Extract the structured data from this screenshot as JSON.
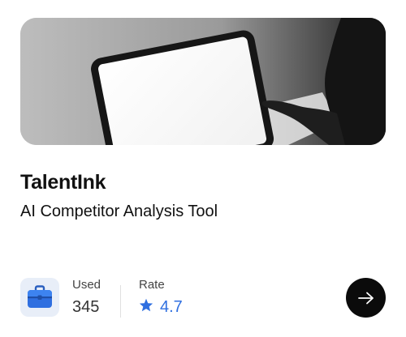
{
  "product": {
    "name": "TalentInk",
    "tagline": "AI Competitor Analysis Tool",
    "icon": "briefcase-icon"
  },
  "stats": {
    "used_label": "Used",
    "used_value": "345",
    "rate_label": "Rate",
    "rate_value": "4.7"
  },
  "colors": {
    "accent": "#2f6fe0",
    "button_bg": "#0b0b0b",
    "icon_tile_bg": "#e8eef8"
  }
}
